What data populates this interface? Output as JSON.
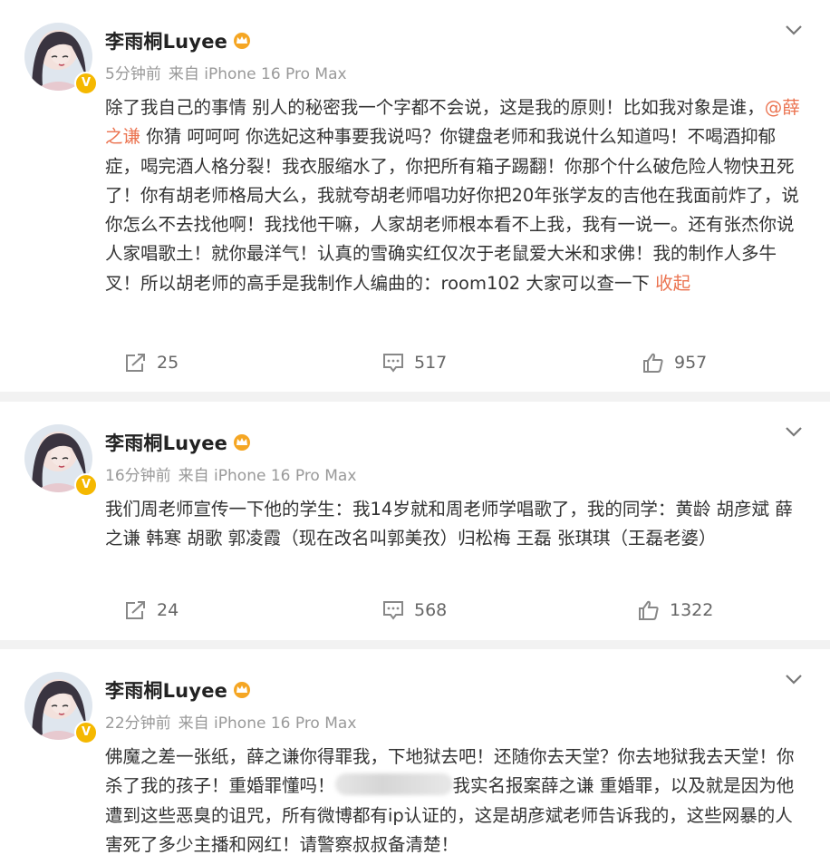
{
  "posts": [
    {
      "author": "李雨桐Luyee",
      "time": "5分钟前",
      "source": "来自 iPhone 16 Pro Max",
      "text_a": "除了我自己的事情 别人的秘密我一个字都不会说，这是我的原则！比如我对象是谁，",
      "mention": "@薛之谦",
      "text_b": " 你猜 呵呵呵 你选妃这种事要我说吗？你键盘老师和我说什么知道吗！不喝酒抑郁症，喝完酒人格分裂！我衣服缩水了，你把所有箱子踢翻！你那个什么破危险人物快丑死了！你有胡老师格局大么，我就夸胡老师唱功好你把20年张学友的吉他在我面前炸了，说你怎么不去找他啊！我找他干嘛，人家胡老师根本看不上我，我有一说一。还有张杰你说人家唱歌土！就你最洋气！认真的雪确实红仅次于老鼠爱大米和求佛！我的制作人多牛叉！所以胡老师的高手是我制作人编曲的：room102 大家可以查一下 ",
      "collapse": "收起",
      "reposts": "25",
      "comments": "517",
      "likes": "957"
    },
    {
      "author": "李雨桐Luyee",
      "time": "16分钟前",
      "source": "来自 iPhone 16 Pro Max",
      "text": "我们周老师宣传一下他的学生：我14岁就和周老师学唱歌了，我的同学：黄龄 胡彦斌 薛之谦 韩寒 胡歌 郭凌霞（现在改名叫郭美孜）归松梅 王磊 张琪琪（王磊老婆）",
      "reposts": "24",
      "comments": "568",
      "likes": "1322"
    },
    {
      "author": "李雨桐Luyee",
      "time": "22分钟前",
      "source": "来自 iPhone 16 Pro Max",
      "text_a": "佛魔之差一张纸，薛之谦你得罪我，下地狱去吧！还随你去天堂？你去地狱我去天堂！你杀了我的孩子！重婚罪懂吗！",
      "text_b": "我实名报案薛之谦 重婚罪，以及就是因为他遭到这些恶臭的诅咒，所有微博都有ip认证的，这是胡彦斌老师告诉我的，这些网暴的人害死了多少主播和网红！请警察叔叔备清楚！"
    }
  ],
  "colors": {
    "accent": "#eb7350",
    "badge": "#f5b800",
    "meta": "#999999"
  }
}
